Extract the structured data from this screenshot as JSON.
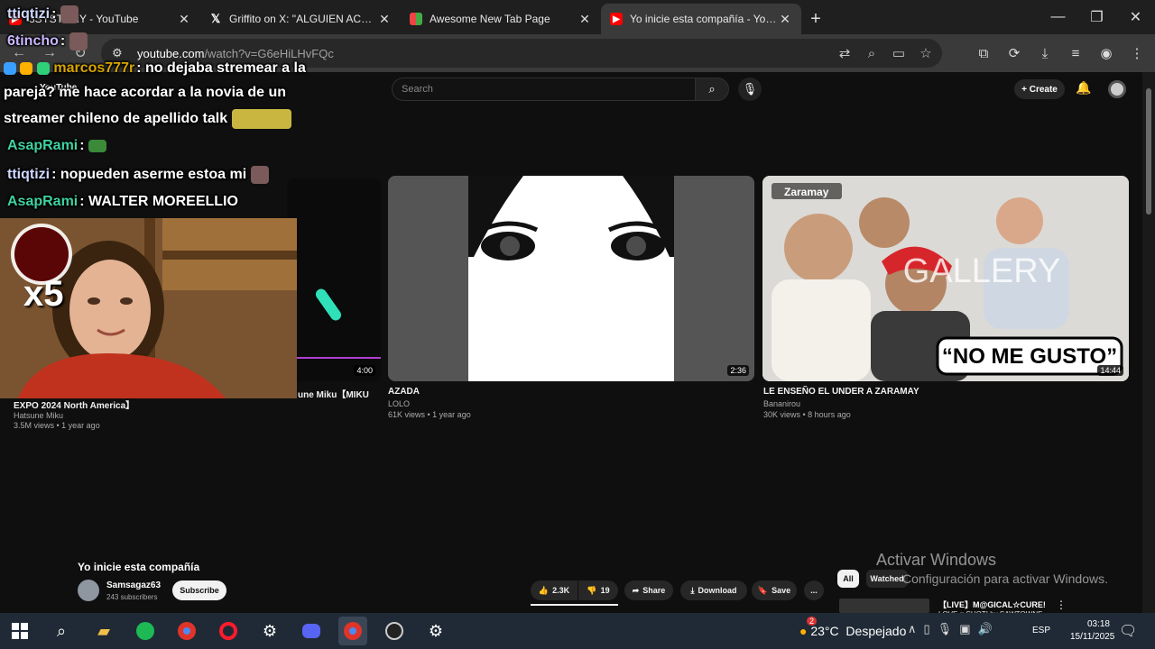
{
  "browser": {
    "tabs": [
      {
        "title": "3SYSTEMY - YouTube",
        "favicon": "youtube-icon",
        "active": false
      },
      {
        "title": "Griffito on X: \"ALGUIEN ACÁ SE",
        "favicon": "x-icon",
        "active": false
      },
      {
        "title": "Awesome New Tab Page",
        "favicon": "grid-icon",
        "active": false
      },
      {
        "title": "Yo inicie esta compañía - YouTu",
        "favicon": "youtube-icon",
        "active": true
      }
    ],
    "new_tab": "+",
    "url_host": "youtube.com",
    "url_path": "/watch?v=G6eHiLHvFQc"
  },
  "youtube": {
    "logo": "YouTube",
    "search_placeholder": "Search",
    "create_label": "Create",
    "videos": [
      {
        "title": "EXPO 2024 North America】",
        "title_prefix": "une Miku【MIKU",
        "channel": "Hatsune Miku",
        "meta": "3.5M views • 1 year ago",
        "duration": "4:00"
      },
      {
        "title": "AZADA",
        "channel": "LOLO",
        "meta": "61K views • 1 year ago",
        "duration": "2:36"
      },
      {
        "title": "LE ENSEÑO EL UNDER A ZARAMAY",
        "channel": "Bananirou",
        "meta": "30K views • 8 hours ago",
        "duration": "14:44",
        "thumb_caption": "“NO ME GUSTO”",
        "thumb_badge": "Zaramay",
        "thumb_watermark": "GALLERY"
      }
    ],
    "player": {
      "title": "Yo inicie esta compañía",
      "channel": "Samsagaz63",
      "subscribers": "243 subscribers",
      "subscribe_label": "Subscribe",
      "likes": "2.3K",
      "dislikes": "19",
      "share": "Share",
      "download": "Download",
      "save": "Save",
      "more": "...",
      "chips": [
        "All",
        "Watched"
      ],
      "up_next_title": "【LIVE】M@GICAL☆CURE!",
      "up_next_sub": "LOVE ♥ SHOT! by SAWTOWNE"
    }
  },
  "chat": [
    {
      "user": "ttiqtizi",
      "text": ":",
      "color": "#cfd8ff"
    },
    {
      "user": "6tincho",
      "text": ":",
      "color": "#c9b6ff"
    },
    {
      "user": "marcos777r",
      "text": ": no dejaba stremear a la",
      "color": "#d9a500"
    },
    {
      "user": "",
      "text": "pareja? me hace acordar a la novia de un",
      "color": "#ffffff"
    },
    {
      "user": "",
      "text": "streamer chileno de apellido talk",
      "color": "#ffffff"
    },
    {
      "user": "AsapRami",
      "text": ":",
      "color": "#3fd1a2"
    },
    {
      "user": "ttiqtizi",
      "text": ": nopueden aserme estoa mi",
      "color": "#cfd8ff"
    },
    {
      "user": "AsapRami",
      "text": ": WALTER MOREELLIO",
      "color": "#3fd1a2"
    }
  ],
  "cam": {
    "multiplier": "x5"
  },
  "watermark": {
    "line1": "Activar Windows",
    "line2": "Configuración para activar Windows."
  },
  "taskbar": {
    "temperature": "23°C",
    "weather_text": "Despejado",
    "weather_badge": "2",
    "language": "ESP",
    "time": "03:18",
    "date": "15/11/2025"
  }
}
